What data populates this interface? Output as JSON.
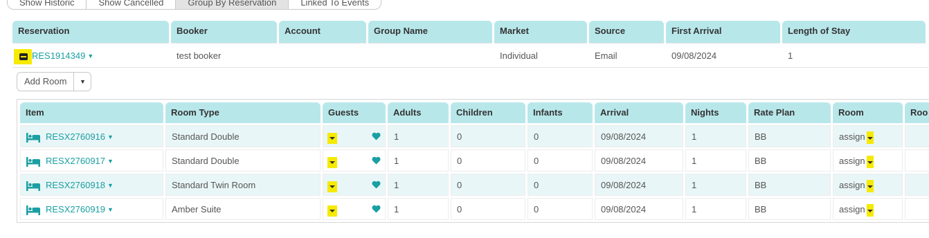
{
  "tabs": [
    {
      "label": "Show Historic",
      "active": false
    },
    {
      "label": "Show Cancelled",
      "active": false
    },
    {
      "label": "Group By Reservation",
      "active": true
    },
    {
      "label": "Linked To Events",
      "active": false
    }
  ],
  "reservation_table": {
    "headers": [
      "Reservation",
      "Booker",
      "Account",
      "Group Name",
      "Market",
      "Source",
      "First Arrival",
      "Length of Stay"
    ],
    "row": {
      "reservation": "RES1914349",
      "booker": "test booker",
      "account": "",
      "group_name": "",
      "market": "Individual",
      "source": "Email",
      "first_arrival": "09/08/2024",
      "length_of_stay": "1"
    }
  },
  "add_room": {
    "label": "Add Room"
  },
  "items_table": {
    "headers": [
      "Item",
      "Room Type",
      "Guests",
      "Adults",
      "Children",
      "Infants",
      "Arrival",
      "Nights",
      "Rate Plan",
      "Room",
      "Roo"
    ],
    "rows": [
      {
        "item": "RESX2760916",
        "room_type": "Standard Double",
        "adults": "1",
        "children": "0",
        "infants": "0",
        "arrival": "09/08/2024",
        "nights": "1",
        "rate_plan": "BB",
        "room": "assign"
      },
      {
        "item": "RESX2760917",
        "room_type": "Standard Double",
        "adults": "1",
        "children": "0",
        "infants": "0",
        "arrival": "09/08/2024",
        "nights": "1",
        "rate_plan": "BB",
        "room": "assign"
      },
      {
        "item": "RESX2760918",
        "room_type": "Standard Twin Room",
        "adults": "1",
        "children": "0",
        "infants": "0",
        "arrival": "09/08/2024",
        "nights": "1",
        "rate_plan": "BB",
        "room": "assign"
      },
      {
        "item": "RESX2760919",
        "room_type": "Amber Suite",
        "adults": "1",
        "children": "0",
        "infants": "0",
        "arrival": "09/08/2024",
        "nights": "1",
        "rate_plan": "BB",
        "room": "assign"
      }
    ]
  },
  "colors": {
    "accent": "#1a9fa3",
    "header_bg": "#b8e7ea",
    "highlight": "#f6ea00"
  },
  "icons": {
    "bed": "bed-icon",
    "heart": "heart-icon",
    "collapse": "collapse-icon"
  }
}
